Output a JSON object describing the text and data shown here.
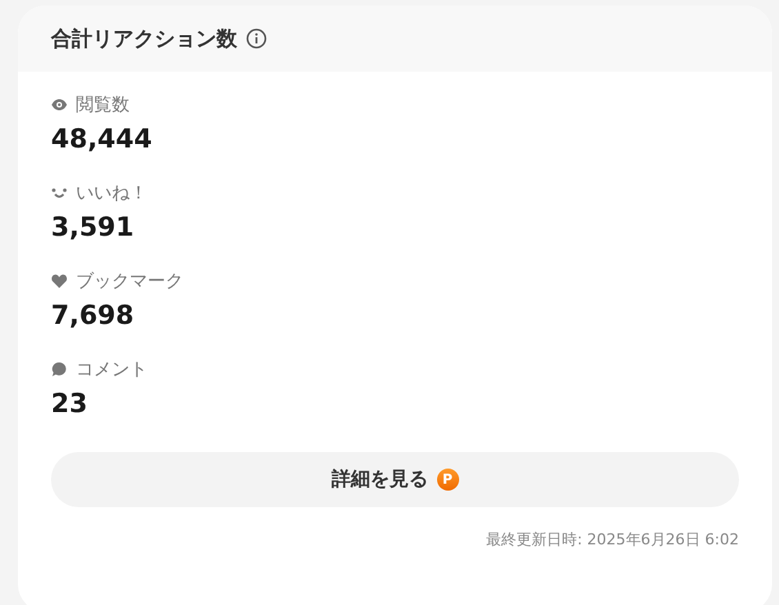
{
  "card": {
    "title": "合計リアクション数"
  },
  "metrics": [
    {
      "kind": "eye",
      "label": "閲覧数",
      "value": "48,444"
    },
    {
      "kind": "smile",
      "label": "いいね！",
      "value": "3,591"
    },
    {
      "kind": "heart",
      "label": "ブックマーク",
      "value": "7,698"
    },
    {
      "kind": "comment",
      "label": "コメント",
      "value": "23"
    }
  ],
  "details_button": {
    "label": "詳細を見る",
    "badge": "P"
  },
  "updated": "最終更新日時: 2025年6月26日 6:02"
}
